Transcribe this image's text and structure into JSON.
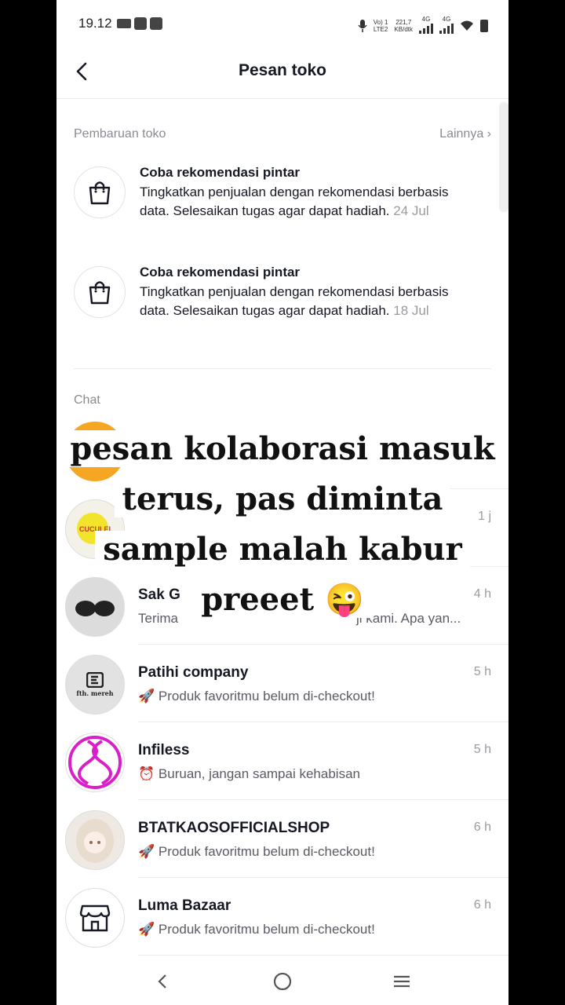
{
  "status_bar": {
    "time": "19.12",
    "net_label_top": "Vo) 1",
    "net_label_bottom": "LTE2",
    "speed_value": "221,7",
    "speed_unit": "KB/dtk",
    "signal1": "4G",
    "signal2": "4G"
  },
  "header": {
    "title": "Pesan toko"
  },
  "updates": {
    "section_label": "Pembaruan toko",
    "more_label": "Lainnya",
    "items": [
      {
        "title": "Coba rekomendasi pintar",
        "body": "Tingkatkan penjualan dengan rekomendasi berbasis data. Selesaikan tugas agar dapat hadiah.",
        "date": "24 Jul",
        "icon": "shopping-bag-icon"
      },
      {
        "title": "Coba rekomendasi pintar",
        "body": "Tingkatkan penjualan dengan rekomendasi berbasis data. Selesaikan tugas agar dapat hadiah.",
        "date": "18 Jul",
        "icon": "shopping-bag-icon"
      }
    ]
  },
  "chat": {
    "section_label": "Chat",
    "items": [
      {
        "name": "",
        "time": "1 j",
        "preview": "",
        "avatar_text": "CUCULEI"
      },
      {
        "name": "Sak G",
        "time": "4 h",
        "preview_left": "Terima",
        "preview_right": "ji kami. Apa yan...",
        "avatar": "glasses-avatar"
      },
      {
        "name": "Patihi company",
        "time": "5 h",
        "emoji": "🚀",
        "preview": "Produk favoritmu belum di-checkout!",
        "avatar_text": "fth. mereh"
      },
      {
        "name": "Infiless",
        "time": "5 h",
        "emoji": "⏰",
        "preview": "Buruan, jangan sampai kehabisan",
        "avatar": "infiless-logo"
      },
      {
        "name": "BTATKAOSOFFICIALSHOP",
        "time": "6 h",
        "emoji": "🚀",
        "preview": "Produk favoritmu belum di-checkout!",
        "avatar": "anime-avatar"
      },
      {
        "name": "Luma Bazaar",
        "time": "6 h",
        "emoji": "🚀",
        "preview": "Produk favoritmu belum di-checkout!",
        "avatar": "store-icon"
      }
    ]
  },
  "caption": {
    "line1": "pesan kolaborasi masuk",
    "line2": "terus, pas diminta",
    "line3": "sample malah kabur",
    "line4": "preeet 😜"
  },
  "colors": {
    "accent_orange": "#f5a623",
    "infiless_magenta": "#d91fc7"
  }
}
